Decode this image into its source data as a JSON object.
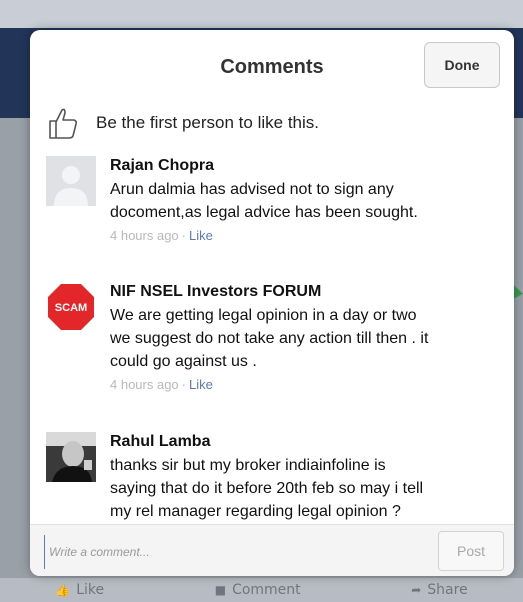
{
  "dialog": {
    "title": "Comments",
    "done_label": "Done",
    "like_prompt": "Be the first person to like this."
  },
  "comments": [
    {
      "author": "Rajan Chopra",
      "lines": [
        "Arun dalmia has advised not to sign any",
        "docoment,as legal advice has been sought."
      ],
      "time": "4 hours ago",
      "like_label": "Like",
      "avatar_icon": "default-avatar-icon"
    },
    {
      "author": "NIF NSEL Investors FORUM",
      "lines": [
        "We are getting legal opinion in a day or two",
        "we suggest do not take any action till then . it",
        "could go against us ."
      ],
      "time": "4 hours ago",
      "like_label": "Like",
      "avatar_icon": "scam-stop-sign-icon",
      "avatar_text": "SCAM"
    },
    {
      "author": "Rahul Lamba",
      "lines": [
        "thanks sir but my broker indiainfoline is",
        "saying that do it before 20th feb so may i tell",
        "my rel manager regarding legal opinion ?"
      ],
      "avatar_icon": "profile-photo-icon"
    }
  ],
  "composer": {
    "placeholder": "Write a comment...",
    "post_label": "Post"
  },
  "bottom_bar": {
    "like": "Like",
    "comment": "Comment",
    "share": "Share"
  },
  "colors": {
    "link_blue": "#5c7cb0",
    "header_band": "#223559",
    "scam_red": "#e3262a"
  }
}
